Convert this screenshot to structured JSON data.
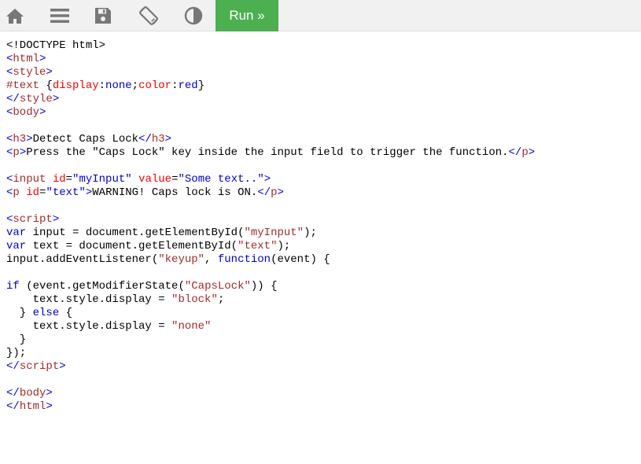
{
  "toolbar": {
    "run_label": "Run »",
    "icons": [
      "home-icon",
      "menu-icon",
      "save-icon",
      "rotate-icon",
      "contrast-icon"
    ]
  },
  "colors": {
    "toolbar_bg": "#f1f1f1",
    "run_bg": "#4caf50",
    "icon": "#777777",
    "tag": "#a52a2a",
    "bracket": "#0000cd",
    "attr": "#ff0000",
    "value": "#0000cd",
    "keyword": "#0000cd",
    "string": "#a52a2a"
  },
  "code_lines": [
    [
      [
        "doctype",
        "<!DOCTYPE html>"
      ]
    ],
    [
      [
        "br",
        "<"
      ],
      [
        "tag",
        "html"
      ],
      [
        "br",
        ">"
      ]
    ],
    [
      [
        "br",
        "<"
      ],
      [
        "tag",
        "style"
      ],
      [
        "br",
        ">"
      ]
    ],
    [
      [
        "css-sel",
        "#text "
      ],
      [
        "plain",
        "{"
      ],
      [
        "css-prop",
        "display"
      ],
      [
        "plain",
        ":"
      ],
      [
        "css-val",
        "none"
      ],
      [
        "plain",
        ";"
      ],
      [
        "css-prop",
        "color"
      ],
      [
        "plain",
        ":"
      ],
      [
        "css-val",
        "red"
      ],
      [
        "plain",
        "}"
      ]
    ],
    [
      [
        "br",
        "</"
      ],
      [
        "tag",
        "style"
      ],
      [
        "br",
        ">"
      ]
    ],
    [
      [
        "br",
        "<"
      ],
      [
        "tag",
        "body"
      ],
      [
        "br",
        ">"
      ]
    ],
    [],
    [
      [
        "br",
        "<"
      ],
      [
        "tag",
        "h3"
      ],
      [
        "br",
        ">"
      ],
      [
        "plain",
        "Detect Caps Lock"
      ],
      [
        "br",
        "</"
      ],
      [
        "tag",
        "h3"
      ],
      [
        "br",
        ">"
      ]
    ],
    [
      [
        "br",
        "<"
      ],
      [
        "tag",
        "p"
      ],
      [
        "br",
        ">"
      ],
      [
        "plain",
        "Press the \"Caps Lock\" key inside the input field to trigger the function."
      ],
      [
        "br",
        "</"
      ],
      [
        "tag",
        "p"
      ],
      [
        "br",
        ">"
      ]
    ],
    [],
    [
      [
        "br",
        "<"
      ],
      [
        "tag",
        "input"
      ],
      [
        "attr",
        " id"
      ],
      [
        "plain",
        "="
      ],
      [
        "val",
        "\"myInput\""
      ],
      [
        "attr",
        " value"
      ],
      [
        "plain",
        "="
      ],
      [
        "val",
        "\"Some text..\""
      ],
      [
        "br",
        ">"
      ]
    ],
    [
      [
        "br",
        "<"
      ],
      [
        "tag",
        "p"
      ],
      [
        "attr",
        " id"
      ],
      [
        "plain",
        "="
      ],
      [
        "val",
        "\"text\""
      ],
      [
        "br",
        ">"
      ],
      [
        "plain",
        "WARNING! Caps lock is ON."
      ],
      [
        "br",
        "</"
      ],
      [
        "tag",
        "p"
      ],
      [
        "br",
        ">"
      ]
    ],
    [],
    [
      [
        "br",
        "<"
      ],
      [
        "tag",
        "script"
      ],
      [
        "br",
        ">"
      ]
    ],
    [
      [
        "kw",
        "var"
      ],
      [
        "plain",
        " input = document.getElementById("
      ],
      [
        "str",
        "\"myInput\""
      ],
      [
        "plain",
        ");"
      ]
    ],
    [
      [
        "kw",
        "var"
      ],
      [
        "plain",
        " text = document.getElementById("
      ],
      [
        "str",
        "\"text\""
      ],
      [
        "plain",
        ");"
      ]
    ],
    [
      [
        "plain",
        "input.addEventListener("
      ],
      [
        "str",
        "\"keyup\""
      ],
      [
        "plain",
        ", "
      ],
      [
        "kw",
        "function"
      ],
      [
        "plain",
        "(event) {"
      ]
    ],
    [],
    [
      [
        "kw",
        "if"
      ],
      [
        "plain",
        " (event.getModifierState("
      ],
      [
        "str",
        "\"CapsLock\""
      ],
      [
        "plain",
        ")) {"
      ]
    ],
    [
      [
        "plain",
        "    text.style.display = "
      ],
      [
        "str",
        "\"block\""
      ],
      [
        "plain",
        ";"
      ]
    ],
    [
      [
        "plain",
        "  } "
      ],
      [
        "kw",
        "else"
      ],
      [
        "plain",
        " {"
      ]
    ],
    [
      [
        "plain",
        "    text.style.display = "
      ],
      [
        "str",
        "\"none\""
      ]
    ],
    [
      [
        "plain",
        "  }"
      ]
    ],
    [
      [
        "plain",
        "});"
      ]
    ],
    [
      [
        "br",
        "</"
      ],
      [
        "tag",
        "script"
      ],
      [
        "br",
        ">"
      ]
    ],
    [],
    [
      [
        "br",
        "</"
      ],
      [
        "tag",
        "body"
      ],
      [
        "br",
        ">"
      ]
    ],
    [
      [
        "br",
        "</"
      ],
      [
        "tag",
        "html"
      ],
      [
        "br",
        ">"
      ]
    ]
  ]
}
